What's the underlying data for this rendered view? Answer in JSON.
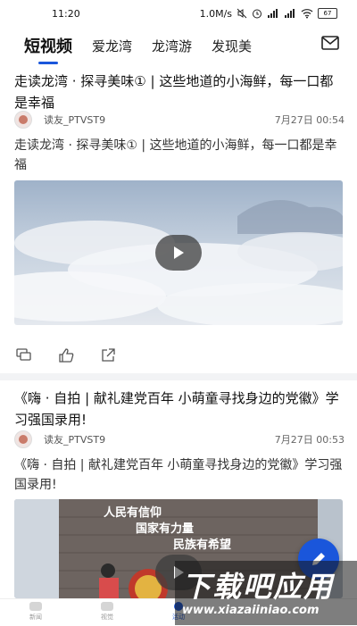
{
  "status_bar": {
    "time": "11:20",
    "network_speed": "1.0M/s",
    "battery": "67"
  },
  "tabs": [
    {
      "label": "短视频",
      "active": true
    },
    {
      "label": "爱龙湾",
      "active": false
    },
    {
      "label": "龙湾游",
      "active": false
    },
    {
      "label": "发现美",
      "active": false
    }
  ],
  "posts": [
    {
      "title": "走读龙湾 · 探寻美味① | 这些地道的小海鲜，每一口都是幸福",
      "author": "读友_PTVST9",
      "date": "7月27日 00:54",
      "summary": "走读龙湾 · 探寻美味① | 这些地道的小海鲜，每一口都是幸福"
    },
    {
      "title": "《嗨 · 自拍 | 献礼建党百年 小萌童寻找身边的党徽》学习强国录用!",
      "author": "读友_PTVST9",
      "date": "7月27日 00:53",
      "summary": "《嗨 · 自拍 | 献礼建党百年 小萌童寻找身边的党徽》学习强国录用!",
      "video_text": {
        "line1": "人民有信仰",
        "line2": "国家有力量",
        "line3": "民族有希望"
      }
    }
  ],
  "bottom_nav": [
    {
      "label": "新闻"
    },
    {
      "label": "视觉"
    },
    {
      "label": "活动"
    },
    {
      "label": ""
    },
    {
      "label": ""
    }
  ],
  "watermark": {
    "title": "下载吧应用",
    "url": "www.xiazaiiniao.com"
  },
  "colors": {
    "accent": "#1a56db",
    "divider": "#f2f3f5"
  }
}
